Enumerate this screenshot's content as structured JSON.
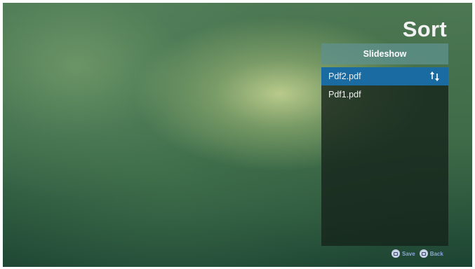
{
  "screen": {
    "title": "Sort",
    "header_button": {
      "label": "Slideshow"
    },
    "list": {
      "items": [
        {
          "label": "Pdf2.pdf",
          "selected": true,
          "icon": "sort-arrows-icon"
        },
        {
          "label": "Pdf1.pdf",
          "selected": false
        }
      ]
    },
    "footer": {
      "save_label": "Save",
      "back_label": "Back",
      "save_icon": "remote-key-icon",
      "back_icon": "remote-key-icon"
    }
  },
  "colors": {
    "selected_row": "#1a6ba2",
    "header_button": "#5f918c",
    "panel": "#14221a",
    "footer_text": "#8aa7d6"
  }
}
